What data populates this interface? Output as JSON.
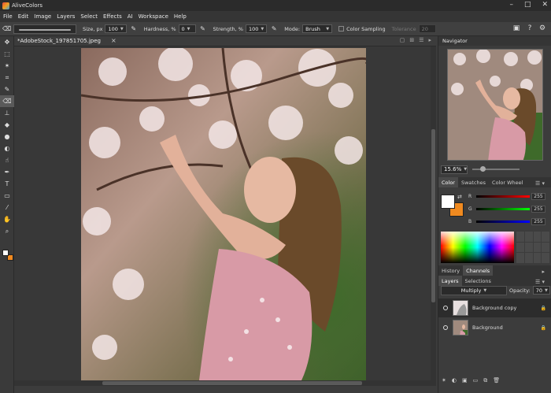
{
  "app": {
    "title": "AliveColors"
  },
  "window_buttons": [
    "–",
    "□",
    "✕"
  ],
  "menu": [
    "File",
    "Edit",
    "Image",
    "Layers",
    "Select",
    "Effects",
    "AI",
    "Workspace",
    "Help"
  ],
  "options": {
    "size_label": "Size, px",
    "size_value": "100",
    "hardness_label": "Hardness, %",
    "hardness_value": "0",
    "strength_label": "Strength, %",
    "strength_value": "100",
    "mode_label": "Mode:",
    "mode_value": "Brush",
    "color_sampling_label": "Color Sampling",
    "tolerance_label": "Tolerance",
    "tolerance_value": "20"
  },
  "document": {
    "tab_name": "*AdobeStock_197851705.jpeg",
    "close": "×"
  },
  "navigator": {
    "title": "Navigator",
    "zoom": "15.6%"
  },
  "color_panel": {
    "tabs": [
      "Color",
      "Swatches",
      "Color Wheel"
    ],
    "active_tab": 0,
    "channels": [
      {
        "label": "R",
        "value": "255",
        "color": "#e03030"
      },
      {
        "label": "G",
        "value": "255",
        "color": "#30c030"
      },
      {
        "label": "B",
        "value": "255",
        "color": "#3050e0"
      }
    ],
    "foreground": "#ffffff",
    "background": "#f08a20"
  },
  "history_panel": {
    "tabs": [
      "History",
      "Channels"
    ],
    "active_tab": 1
  },
  "layers_panel": {
    "tabs": [
      "Layers",
      "Selections"
    ],
    "active_tab": 0,
    "blend_mode": "Multiply",
    "opacity_label": "Opacity:",
    "opacity_value": "70",
    "layers": [
      {
        "name": "Background copy",
        "selected": true
      },
      {
        "name": "Background",
        "selected": false
      }
    ]
  }
}
